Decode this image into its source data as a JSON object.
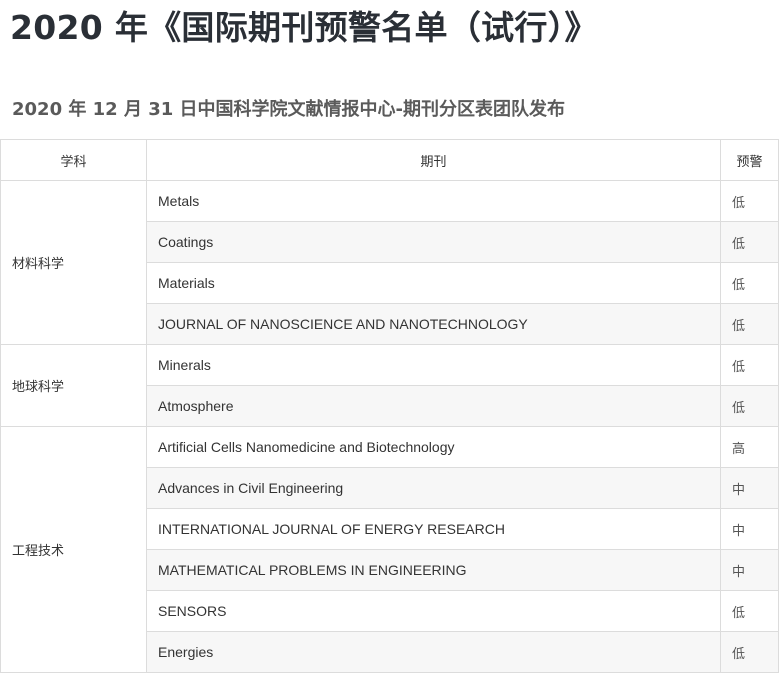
{
  "page": {
    "title": "2020 年《国际期刊预警名单（试行）》",
    "subtitle": "2020 年 12 月 31 日中国科学院文献情报中心-期刊分区表团队发布"
  },
  "table": {
    "headers": {
      "subject": "学科",
      "journal": "期刊",
      "warning": "预警"
    },
    "groups": [
      {
        "subject": "材料科学",
        "rows": [
          {
            "journal": "Metals",
            "level": "低"
          },
          {
            "journal": "Coatings",
            "level": "低"
          },
          {
            "journal": "Materials",
            "level": "低"
          },
          {
            "journal": "JOURNAL OF NANOSCIENCE AND NANOTECHNOLOGY",
            "level": "低"
          }
        ]
      },
      {
        "subject": "地球科学",
        "rows": [
          {
            "journal": "Minerals",
            "level": "低"
          },
          {
            "journal": "Atmosphere",
            "level": "低"
          }
        ]
      },
      {
        "subject": "工程技术",
        "rows": [
          {
            "journal": "Artificial Cells Nanomedicine and Biotechnology",
            "level": "高"
          },
          {
            "journal": "Advances in Civil Engineering",
            "level": "中"
          },
          {
            "journal": "INTERNATIONAL JOURNAL OF ENERGY RESEARCH",
            "level": "中"
          },
          {
            "journal": "MATHEMATICAL PROBLEMS IN ENGINEERING",
            "level": "中"
          },
          {
            "journal": "SENSORS",
            "level": "低"
          },
          {
            "journal": "Energies",
            "level": "低"
          }
        ]
      }
    ]
  }
}
